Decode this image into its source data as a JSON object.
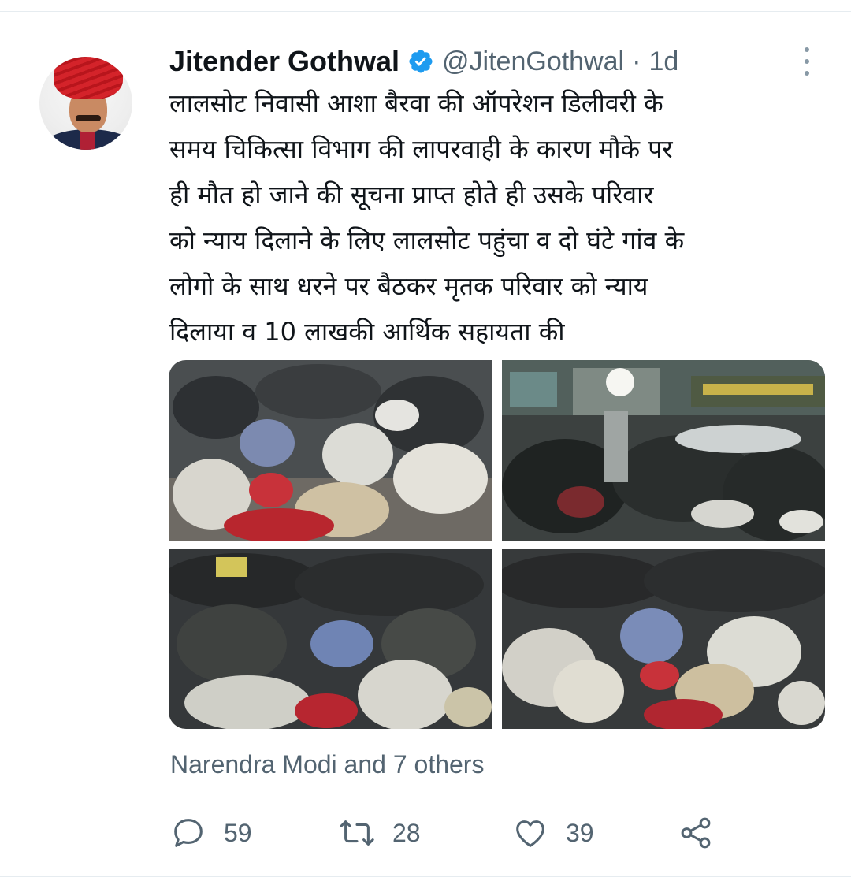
{
  "tweet": {
    "author_name": "Jitender Gothwal",
    "handle": "@JitenGothwal",
    "separator": "·",
    "time": "1d",
    "text_lines": [
      "लालसोट निवासी आशा बैरवा की ऑपरेशन डिलीवरी के",
      "समय चिकित्सा विभाग की लापरवाही के कारण मौके पर",
      "ही मौत हो जाने की सूचना प्राप्त होते ही उसके परिवार",
      "को न्याय दिलाने के लिए लालसोट पहुंचा व दो घंटे गांव के",
      "लोगो के साथ धरने पर बैठकर मृतक परिवार को न्याय",
      "दिलाया व 10 लाखकी आर्थिक सहायता की"
    ],
    "liked_by": "Narendra Modi and 7 others",
    "counts": {
      "replies": "59",
      "retweets": "28",
      "likes": "39"
    }
  },
  "icons": {
    "verified": "verified-badge-icon",
    "more": "more-vertical-icon",
    "reply": "reply-bubble-icon",
    "retweet": "retweet-icon",
    "like": "heart-icon",
    "share": "share-icon"
  },
  "colors": {
    "verified": "#1d9bf0",
    "secondary_text": "#536471",
    "primary_text": "#0f1419"
  }
}
